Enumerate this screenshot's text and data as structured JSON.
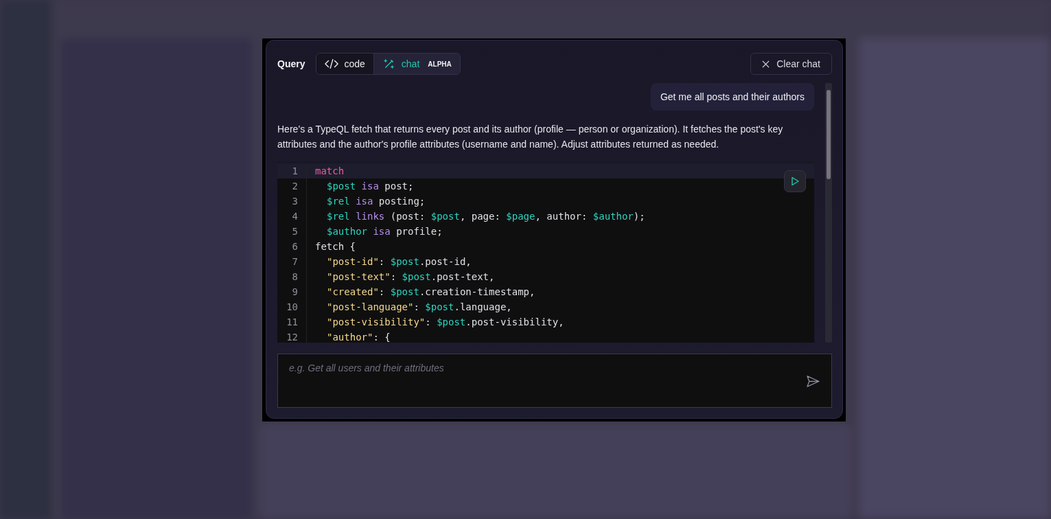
{
  "dialog": {
    "title": "Query",
    "modes": [
      {
        "label": "code",
        "selected": false,
        "kind": "code"
      },
      {
        "label": "chat",
        "selected": true,
        "kind": "chat",
        "badge": "ALPHA"
      }
    ],
    "clear_button": "Clear chat",
    "messages": [
      {
        "kind": "user",
        "text": "Get me all posts and their authors"
      },
      {
        "kind": "assistant",
        "text": "Here’s a TypeQL fetch that returns every post and its author (profile — person or organization). It fetches the post's key attributes and the author's profile attributes (username and name). Adjust attributes returned as needed."
      }
    ],
    "code": [
      {
        "number": "1",
        "active": true,
        "indent": false,
        "tokens": [
          {
            "text": "match",
            "kind": "keyword"
          }
        ]
      },
      {
        "number": "2",
        "active": false,
        "indent": true,
        "tokens": [
          {
            "text": "$post",
            "kind": "var"
          },
          {
            "text": " isa",
            "kind": "op"
          },
          {
            "text": " post;"
          }
        ]
      },
      {
        "number": "3",
        "active": false,
        "indent": true,
        "tokens": [
          {
            "text": "$rel",
            "kind": "var"
          },
          {
            "text": " isa",
            "kind": "op"
          },
          {
            "text": " posting;"
          }
        ]
      },
      {
        "number": "4",
        "active": false,
        "indent": true,
        "tokens": [
          {
            "text": "$rel",
            "kind": "var"
          },
          {
            "text": " links",
            "kind": "op"
          },
          {
            "text": " (post: "
          },
          {
            "text": "$post",
            "kind": "var"
          },
          {
            "text": ", page: "
          },
          {
            "text": "$page",
            "kind": "var"
          },
          {
            "text": ", author: "
          },
          {
            "text": "$author",
            "kind": "var"
          },
          {
            "text": ");"
          }
        ]
      },
      {
        "number": "5",
        "active": false,
        "indent": true,
        "tokens": [
          {
            "text": "$author",
            "kind": "var"
          },
          {
            "text": " isa",
            "kind": "op"
          },
          {
            "text": " profile;"
          }
        ]
      },
      {
        "number": "6",
        "active": false,
        "indent": false,
        "tokens": [
          {
            "text": "fetch {"
          }
        ]
      },
      {
        "number": "7",
        "active": false,
        "indent": true,
        "tokens": [
          {
            "text": "\"post-id\"",
            "kind": "string"
          },
          {
            "text": ": "
          },
          {
            "text": "$post",
            "kind": "var"
          },
          {
            "text": ".post-id,"
          }
        ]
      },
      {
        "number": "8",
        "active": false,
        "indent": true,
        "tokens": [
          {
            "text": "\"post-text\"",
            "kind": "string"
          },
          {
            "text": ": "
          },
          {
            "text": "$post",
            "kind": "var"
          },
          {
            "text": ".post-text,"
          }
        ]
      },
      {
        "number": "9",
        "active": false,
        "indent": true,
        "tokens": [
          {
            "text": "\"created\"",
            "kind": "string"
          },
          {
            "text": ": "
          },
          {
            "text": "$post",
            "kind": "var"
          },
          {
            "text": ".creation-timestamp,"
          }
        ]
      },
      {
        "number": "10",
        "active": false,
        "indent": true,
        "tokens": [
          {
            "text": "\"post-language\"",
            "kind": "string"
          },
          {
            "text": ": "
          },
          {
            "text": "$post",
            "kind": "var"
          },
          {
            "text": ".language,"
          }
        ]
      },
      {
        "number": "11",
        "active": false,
        "indent": true,
        "tokens": [
          {
            "text": "\"post-visibility\"",
            "kind": "string"
          },
          {
            "text": ": "
          },
          {
            "text": "$post",
            "kind": "var"
          },
          {
            "text": ".post-visibility,"
          }
        ]
      },
      {
        "number": "12",
        "active": false,
        "indent": true,
        "tokens": [
          {
            "text": "\"author\"",
            "kind": "string"
          },
          {
            "text": ": {"
          }
        ]
      }
    ],
    "input": {
      "placeholder": "e.g. Get all users and their attributes"
    }
  }
}
